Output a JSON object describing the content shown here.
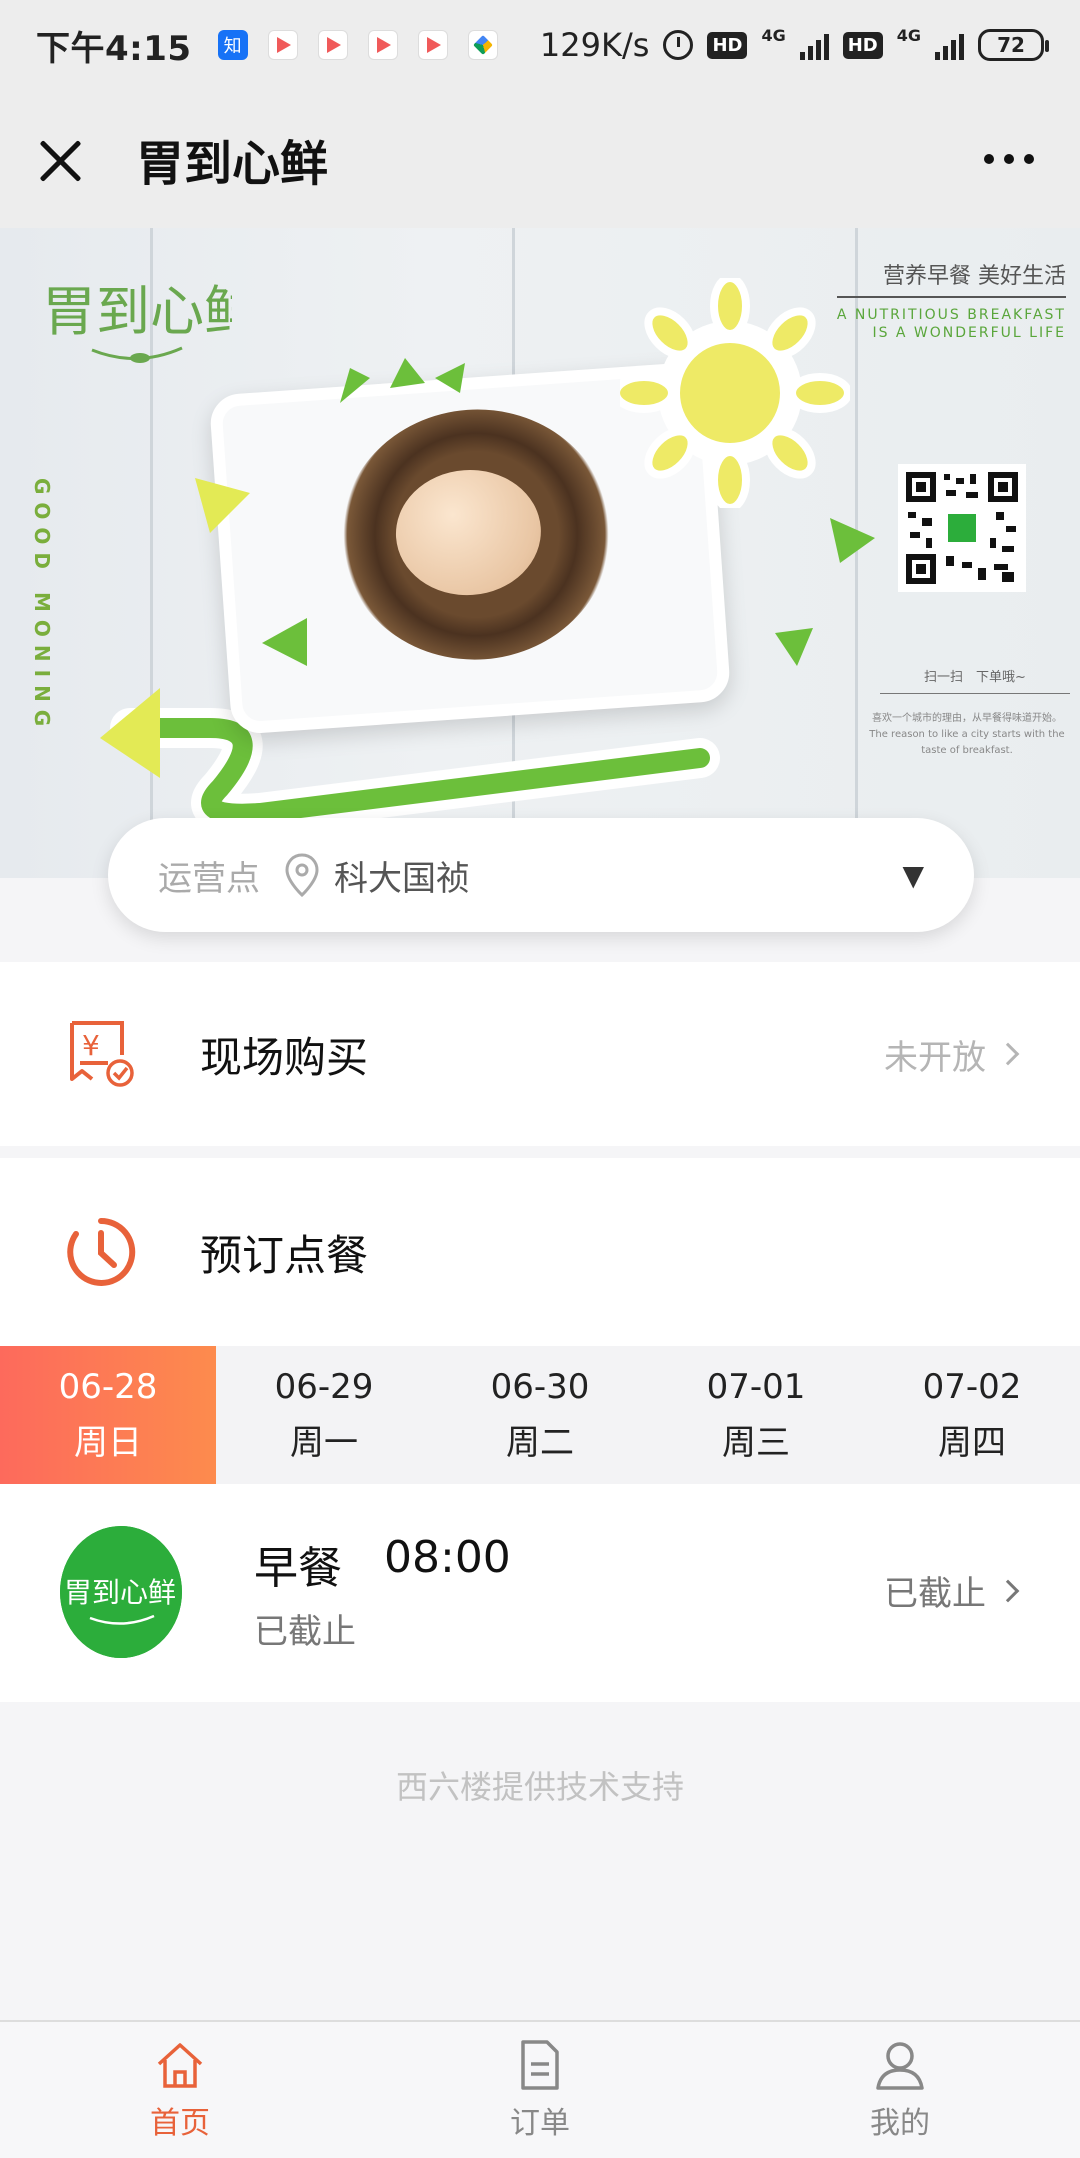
{
  "status_bar": {
    "time": "下午4:15",
    "speed": "129K/s",
    "hd1": "HD",
    "hd2": "HD",
    "net1": "4G",
    "net2": "4G",
    "battery": "72",
    "app_icons": [
      "zhihu-icon",
      "play-icon",
      "play-icon",
      "play-icon",
      "play-icon",
      "drive-icon"
    ]
  },
  "header": {
    "title": "胃到心鲜",
    "close_icon": "close-icon",
    "more_icon": "more-icon"
  },
  "banner": {
    "logo_text": "胃到心鲜",
    "side_text": "GOOD MONING",
    "tagline_cn": "营养早餐 美好生活",
    "tagline_en_1": "A NUTRITIOUS BREAKFAST",
    "tagline_en_2": "IS A WONDERFUL LIFE",
    "qr_caption": "扫一扫　下单哦~",
    "qr_sub_1": "喜欢一个城市的理由，从早餐得味道开始。",
    "qr_sub_2": "The reason to like a city starts with the taste of breakfast."
  },
  "location": {
    "label": "运营点",
    "value": "科大国祯",
    "caret": "▼"
  },
  "rows": {
    "buy_label": "现场购买",
    "buy_status": "未开放",
    "reserve_label": "预订点餐"
  },
  "dates": [
    {
      "date": "06-28",
      "weekday": "周日",
      "selected": true
    },
    {
      "date": "06-29",
      "weekday": "周一",
      "selected": false
    },
    {
      "date": "06-30",
      "weekday": "周二",
      "selected": false
    },
    {
      "date": "07-01",
      "weekday": "周三",
      "selected": false
    },
    {
      "date": "07-02",
      "weekday": "周四",
      "selected": false
    }
  ],
  "meal": {
    "logo_text": "胃到心鲜",
    "name": "早餐",
    "time": "08:00",
    "sub": "已截止",
    "status": "已截止"
  },
  "footer_note": "西六楼提供技术支持",
  "nav": {
    "home": "首页",
    "orders": "订单",
    "mine": "我的"
  },
  "colors": {
    "accent": "#e8623a",
    "date_gradient_start": "#fd6a5c",
    "date_gradient_end": "#fd8b4d",
    "brand_green": "#2cad3b"
  }
}
